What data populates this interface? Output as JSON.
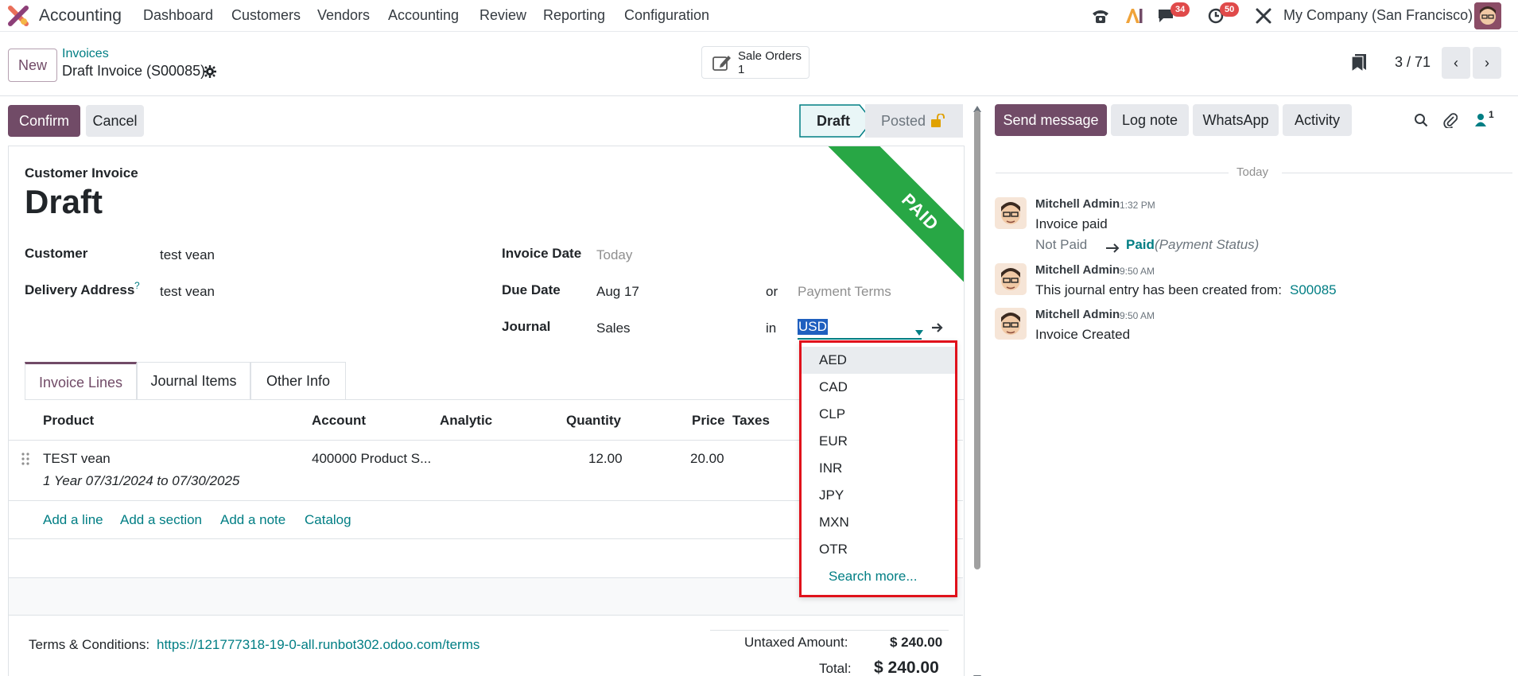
{
  "navbar": {
    "app_name": "Accounting",
    "menus": [
      "Dashboard",
      "Customers",
      "Vendors",
      "Accounting",
      "Review",
      "Reporting",
      "Configuration"
    ],
    "messages_badge": "34",
    "activities_badge": "50",
    "company": "My Company (San Francisco)"
  },
  "control_panel": {
    "new_label": "New",
    "breadcrumb_parent": "Invoices",
    "record_title": "Draft Invoice (S00085)",
    "smart_button_label": "Sale Orders",
    "smart_button_count": "1",
    "pager": "3 / 71"
  },
  "statusbar": {
    "confirm_label": "Confirm",
    "cancel_label": "Cancel",
    "stages": [
      "Draft",
      "Posted"
    ],
    "active_stage": "Draft"
  },
  "form": {
    "ribbon": "PAID",
    "type_label": "Customer Invoice",
    "name": "Draft",
    "customer_label": "Customer",
    "customer_value": "test vean",
    "delivery_label": "Delivery Address",
    "delivery_tooltip": "?",
    "delivery_value": "test vean",
    "invoice_date_label": "Invoice Date",
    "invoice_date_placeholder": "Today",
    "due_date_label": "Due Date",
    "due_date_value": "Aug 17",
    "or_text": "or",
    "payment_terms_placeholder": "Payment Terms",
    "journal_label": "Journal",
    "journal_value": "Sales",
    "in_text": "in",
    "currency_value": "USD"
  },
  "tabs": [
    "Invoice Lines",
    "Journal Items",
    "Other Info"
  ],
  "lines_table": {
    "headers": [
      "Product",
      "Account",
      "Analytic",
      "Quantity",
      "Price",
      "Taxes"
    ],
    "rows": [
      {
        "product": "TEST vean",
        "description": "1 Year 07/31/2024 to 07/30/2025",
        "account": "400000 Product S...",
        "quantity": "12.00",
        "price": "20.00"
      }
    ],
    "actions": [
      "Add a line",
      "Add a section",
      "Add a note",
      "Catalog"
    ]
  },
  "currency_dropdown": {
    "options": [
      "AED",
      "CAD",
      "CLP",
      "EUR",
      "INR",
      "JPY",
      "MXN",
      "OTR"
    ],
    "search_more": "Search more..."
  },
  "footer": {
    "terms_label": "Terms & Conditions:",
    "terms_link": "https://121777318-19-0-all.runbot302.odoo.com/terms",
    "untaxed_label": "Untaxed Amount:",
    "untaxed_value": "$ 240.00",
    "total_label": "Total:",
    "total_value": "$ 240.00"
  },
  "chatter": {
    "buttons": [
      "Send message",
      "Log note",
      "WhatsApp",
      "Activity"
    ],
    "followers_count": "1",
    "date_separator": "Today",
    "messages": [
      {
        "author": "Mitchell Admin",
        "time": "1:32 PM",
        "body": "Invoice paid",
        "tracking_old": "Not Paid",
        "tracking_new": "Paid",
        "tracking_field": "(Payment Status)"
      },
      {
        "author": "Mitchell Admin",
        "time": "9:50 AM",
        "body": "This journal entry has been created from:",
        "link": "S00085"
      },
      {
        "author": "Mitchell Admin",
        "time": "9:50 AM",
        "body": "Invoice Created"
      }
    ]
  },
  "colors": {
    "primary": "#714b67",
    "link": "#017e84",
    "ribbon": "#28a745",
    "badge": "#e04a4a",
    "highlight_box": "#e0111b"
  }
}
